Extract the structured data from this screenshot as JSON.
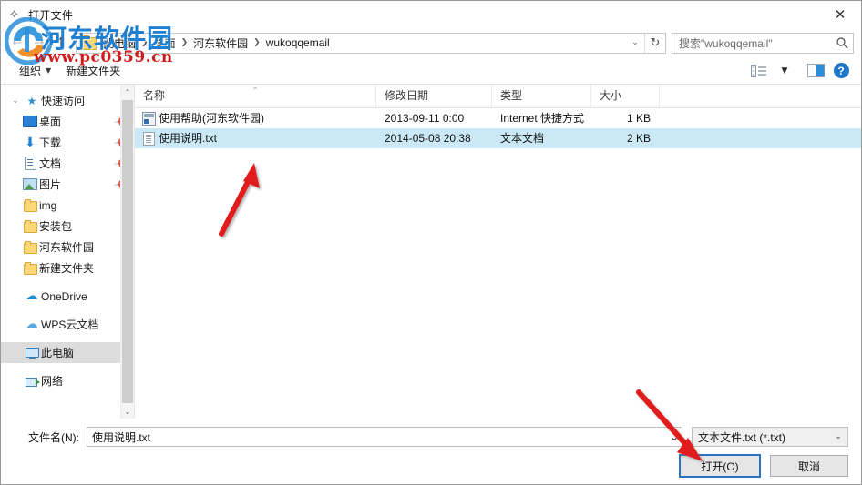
{
  "window": {
    "title": "打开文件",
    "title_icon": "sparkle-icon",
    "close_label": "✕"
  },
  "navbar": {
    "back_icon": "back-arrow-icon",
    "forward_icon": "forward-arrow-icon",
    "up_icon": "↑",
    "folder_icon": "folder-icon",
    "breadcrumbs": [
      "此电脑",
      "桌面",
      "河东软件园",
      "wukoqqemail"
    ],
    "separator": "❯",
    "dropdown_caret": "⌄",
    "refresh_icon": "↻",
    "search": {
      "placeholder": "搜索\"wukoqqemail\"",
      "icon": "search-icon"
    }
  },
  "toolbar": {
    "organize_label": "组织",
    "organize_caret": "▼",
    "new_folder_label": "新建文件夹",
    "view_icon": "list-view-icon",
    "view_caret": "▼",
    "preview_pane_icon": "preview-pane-icon",
    "help_icon": "?"
  },
  "sidebar": {
    "collapse_caret": "⌄",
    "expand_caret": "❯",
    "pin_glyph": "📌",
    "items": [
      {
        "label": "快速访问",
        "icon": "star-icon",
        "level": 1,
        "chevron": "⌄",
        "pinned": false,
        "selected": false
      },
      {
        "label": "桌面",
        "icon": "desktop-icon",
        "level": 2,
        "chevron": "",
        "pinned": true,
        "selected": false
      },
      {
        "label": "下载",
        "icon": "download-icon",
        "level": 2,
        "chevron": "",
        "pinned": true,
        "selected": false
      },
      {
        "label": "文档",
        "icon": "document-icon",
        "level": 2,
        "chevron": "",
        "pinned": true,
        "selected": false
      },
      {
        "label": "图片",
        "icon": "pictures-icon",
        "level": 2,
        "chevron": "",
        "pinned": true,
        "selected": false
      },
      {
        "label": "img",
        "icon": "folder-icon",
        "level": 2,
        "chevron": "",
        "pinned": false,
        "selected": false
      },
      {
        "label": "安装包",
        "icon": "folder-icon",
        "level": 2,
        "chevron": "",
        "pinned": false,
        "selected": false
      },
      {
        "label": "河东软件园",
        "icon": "folder-icon",
        "level": 2,
        "chevron": "",
        "pinned": false,
        "selected": false
      },
      {
        "label": "新建文件夹",
        "icon": "folder-icon",
        "level": 2,
        "chevron": "",
        "pinned": false,
        "selected": false
      },
      {
        "label": "OneDrive",
        "icon": "onedrive-icon",
        "level": 1,
        "chevron": "",
        "pinned": false,
        "selected": false
      },
      {
        "label": "WPS云文档",
        "icon": "cloud-icon",
        "level": 1,
        "chevron": "",
        "pinned": false,
        "selected": false
      },
      {
        "label": "此电脑",
        "icon": "this-pc-icon",
        "level": 1,
        "chevron": "",
        "pinned": false,
        "selected": true
      },
      {
        "label": "网络",
        "icon": "network-icon",
        "level": 1,
        "chevron": "",
        "pinned": false,
        "selected": false
      }
    ],
    "scroll_up": "⌃",
    "scroll_down": "⌄"
  },
  "filelist": {
    "columns": [
      "名称",
      "修改日期",
      "类型",
      "大小"
    ],
    "sort_indicator": "⌃",
    "rows": [
      {
        "name": "使用帮助(河东软件园)",
        "date": "2013-09-11 0:00",
        "type": "Internet 快捷方式",
        "size": "1 KB",
        "icon": "internet-shortcut-icon",
        "selected": false
      },
      {
        "name": "使用说明.txt",
        "date": "2014-05-08 20:38",
        "type": "文本文档",
        "size": "2 KB",
        "icon": "text-file-icon",
        "selected": true
      }
    ]
  },
  "footer": {
    "filename_label": "文件名(N):",
    "filename_value": "使用说明.txt",
    "filename_caret": "⌄",
    "filetype_value": "文本文件.txt (*.txt)",
    "filetype_caret": "⌄",
    "open_button": "打开(O)",
    "cancel_button": "取消"
  },
  "watermark": {
    "site_name": "河东软件园",
    "url": "www.pc0359.cn",
    "logo": "hedong-logo-icon"
  },
  "annotations": {
    "arrow_to_file": "red-arrow-up-right",
    "arrow_to_open": "red-arrow-down-right",
    "arrow_color": "#e01b1b"
  },
  "colors": {
    "selection": "#cbe8f6",
    "sidebar_selection": "#dcdcdc",
    "accent": "#2a72bd",
    "help_blue": "#1e76c8",
    "watermark_blue": "#1f7fd0",
    "watermark_red": "#cf1b1b"
  }
}
